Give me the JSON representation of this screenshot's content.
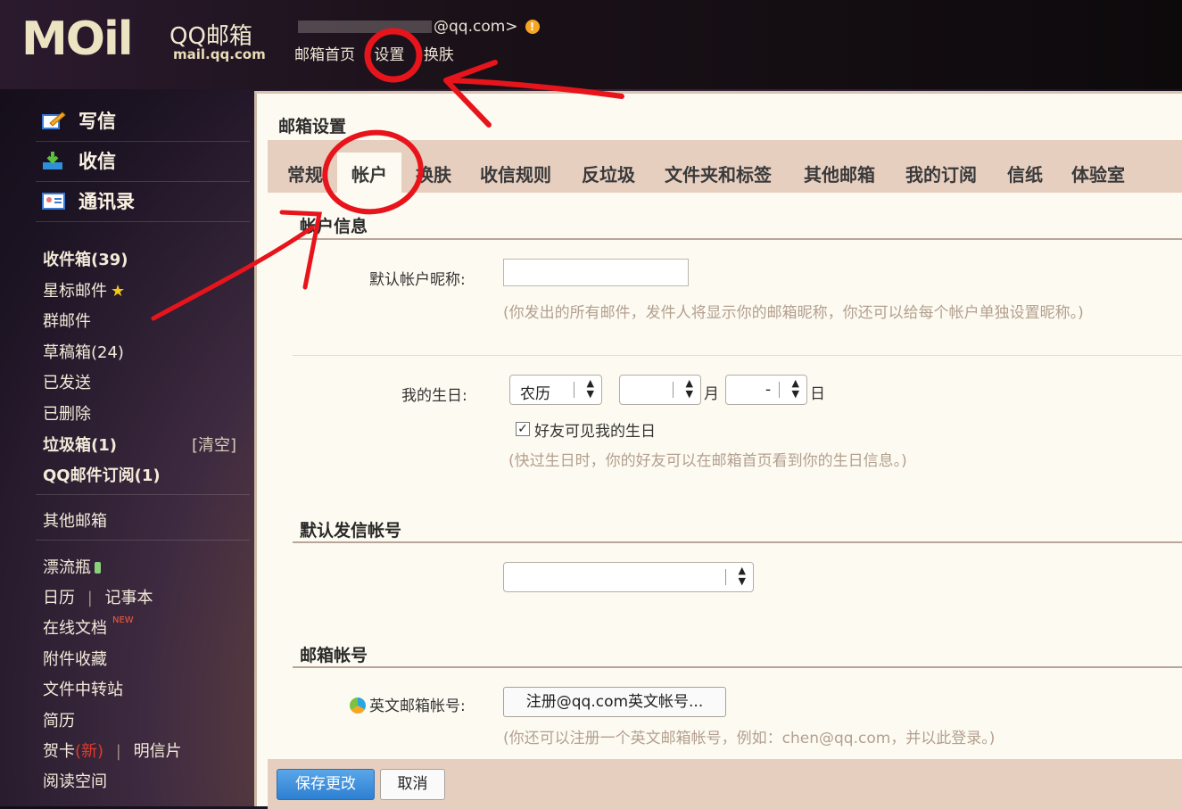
{
  "header": {
    "logo_mark": "MOil",
    "logo_product": "QQ邮箱",
    "logo_domain": "mail.qq.com",
    "user_email_suffix": "@qq.com>",
    "nav": [
      "邮箱首页",
      "设置",
      "换肤"
    ]
  },
  "sidebar": {
    "main_actions": [
      {
        "label": "写信",
        "icon": "compose-icon"
      },
      {
        "label": "收信",
        "icon": "inbox-download-icon"
      },
      {
        "label": "通讯录",
        "icon": "contacts-icon"
      }
    ],
    "folders": {
      "inbox": "收件箱(39)",
      "starred": "星标邮件",
      "group": "群邮件",
      "drafts": "草稿箱(24)",
      "sent": "已发送",
      "deleted": "已删除",
      "spam": "垃圾箱(1)",
      "spam_clear": "[清空]",
      "subscriptions": "QQ邮件订阅(1)"
    },
    "other_mail": "其他邮箱",
    "apps": {
      "bottle": "漂流瓶",
      "calendar": "日历",
      "divider": "|",
      "notes": "记事本",
      "docs": "在线文档",
      "docs_badge": "NEW",
      "attachments": "附件收藏",
      "transfer": "文件中转站",
      "resume": "简历",
      "cards": "贺卡",
      "cards_new": "(新)",
      "postcard": "明信片",
      "reading": "阅读空间"
    }
  },
  "panel": {
    "title": "邮箱设置",
    "tabs": [
      "常规",
      "帐户",
      "换肤",
      "收信规则",
      "反垃圾",
      "文件夹和标签",
      "其他邮箱",
      "我的订阅",
      "信纸",
      "体验室"
    ],
    "active_tab": "帐户",
    "account_info": {
      "section_title": "帐户信息",
      "nickname_label": "默认帐户昵称:",
      "nickname_value": "",
      "nickname_hint": "(你发出的所有邮件，发件人将显示你的邮箱昵称，你还可以给每个帐户单独设置昵称。)",
      "birthday_label": "我的生日:",
      "calendar_type": "农历",
      "month_value": "",
      "month_unit": "月",
      "day_value": "-",
      "day_unit": "日",
      "friends_visible_label": "好友可见我的生日",
      "friends_visible_checked": true,
      "birthday_hint": "(快过生日时，你的好友可以在邮箱首页看到你的生日信息。)"
    },
    "default_sender": {
      "section_title": "默认发信帐号",
      "value": ""
    },
    "mail_account": {
      "section_title": "邮箱帐号",
      "english_label": "英文邮箱帐号:",
      "register_button": "注册@qq.com英文帐号...",
      "hint": "(你还可以注册一个英文邮箱帐号，例如：chen@qq.com，并以此登录。)"
    },
    "buttons": {
      "save": "保存更改",
      "cancel": "取消"
    }
  },
  "colors": {
    "annotation": "#e8141c",
    "tab_bar": "#e7cfc0",
    "panel_bg": "#fdfbf1",
    "primary_button": "#2d7fd2"
  }
}
